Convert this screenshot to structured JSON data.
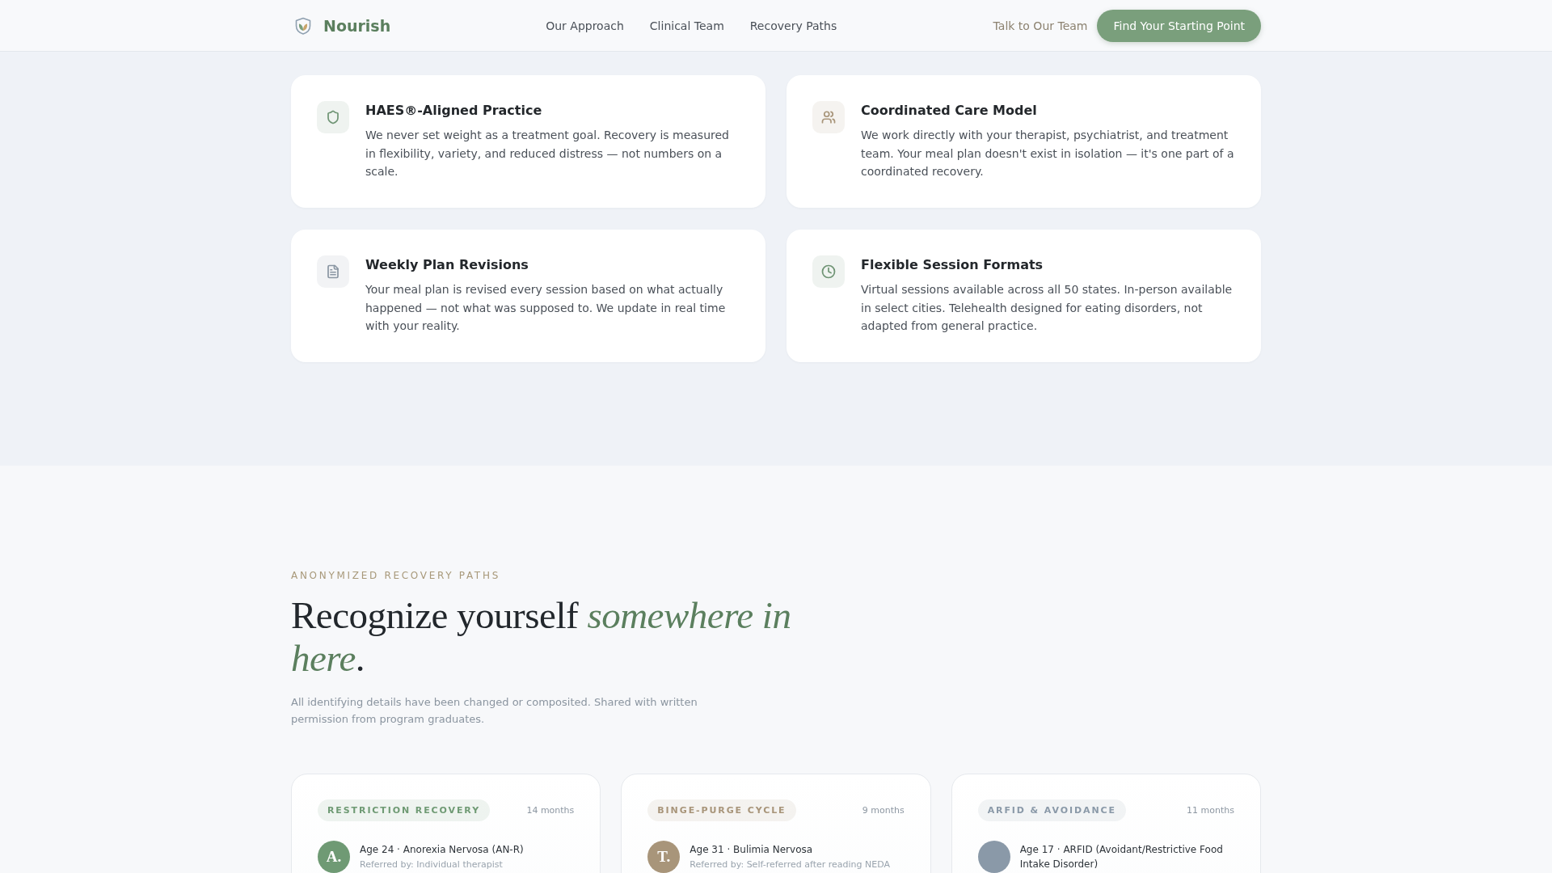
{
  "header": {
    "brand": "Nourish",
    "nav": [
      "Our Approach",
      "Clinical Team",
      "Recovery Paths"
    ],
    "link": "Talk to Our Team",
    "cta": "Find Your Starting Point"
  },
  "features": [
    {
      "title": "HAES®-Aligned Practice",
      "text": "We never set weight as a treatment goal. Recovery is measured in flexibility, variety, and reduced distress — not numbers on a scale.",
      "color": "#6f9474"
    },
    {
      "title": "Coordinated Care Model",
      "text": "We work directly with your therapist, psychiatrist, and treatment team. Your meal plan doesn't exist in isolation — it's one part of a coordinated recovery.",
      "color": "#a8957a"
    },
    {
      "title": "Weekly Plan Revisions",
      "text": "Your meal plan is revised every session based on what actually happened — not what was supposed to. We update in real time with your reality.",
      "color": "#8a96a3"
    },
    {
      "title": "Flexible Session Formats",
      "text": "Virtual sessions available across all 50 states. In-person available in select cities. Telehealth designed for eating disorders, not adapted from general practice.",
      "color": "#6f9474"
    }
  ],
  "paths_section": {
    "eyebrow": "ANONYMIZED RECOVERY PATHS",
    "heading": "Recognize yourself *somewhere in here*.",
    "subtitle": "All identifying details have been changed or composited. Shared with written permission from program graduates.",
    "paths": [
      {
        "tag": "RESTRICTION RECOVERY",
        "duration": "14 months",
        "color": "#6f9a74",
        "initial": "A.",
        "summary": "Age 24 · Anorexia Nervosa (AN-R)",
        "referral": "Referred by: Individual therapist"
      },
      {
        "tag": "BINGE-PURGE CYCLE",
        "duration": "9 months",
        "color": "#a8957a",
        "initial": "T.",
        "summary": "Age 31 · Bulimia Nervosa",
        "referral": "Referred by: Self-referred after reading NEDA"
      },
      {
        "tag": "ARFID & AVOIDANCE",
        "duration": "11 months",
        "color": "#8a99a8",
        "summary": "Age 17 · ARFID (Avoidant/Restrictive Food Intake Disorder)"
      }
    ]
  }
}
